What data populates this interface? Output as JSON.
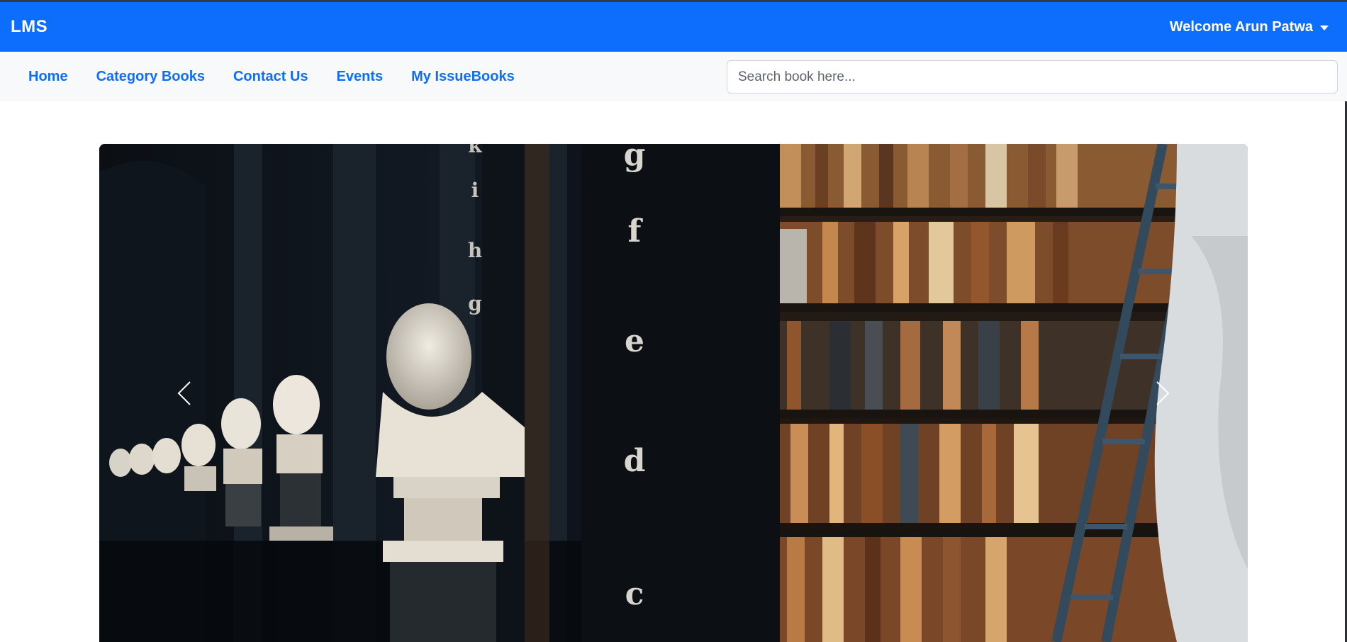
{
  "header": {
    "brand": "LMS",
    "welcome": "Welcome Arun Patwa"
  },
  "nav": {
    "items": [
      {
        "label": "Home"
      },
      {
        "label": "Category Books"
      },
      {
        "label": "Contact Us"
      },
      {
        "label": "Events"
      },
      {
        "label": "My IssueBooks"
      }
    ]
  },
  "search": {
    "placeholder": "Search book here...",
    "value": ""
  },
  "carousel": {
    "shelf_letters": [
      "k",
      "i",
      "h",
      "g",
      "g",
      "f",
      "e",
      "d",
      "c"
    ],
    "prev_icon": "chevron-left-icon",
    "next_icon": "chevron-right-icon"
  },
  "colors": {
    "primary": "#0d6efd",
    "navbar_bg": "#f8f9fa",
    "top_border": "#343a40"
  }
}
